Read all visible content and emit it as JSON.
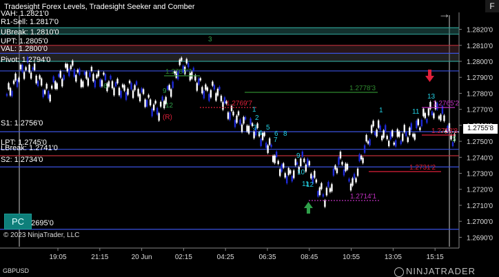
{
  "title": "Tradesight Forex Levels, Tradesight Seeker and Comber",
  "instrument": "GBPUSD",
  "copyright": "© 2023 NinjaTrader, LLC",
  "brand": "NINJATRADER",
  "buttons": {
    "pc": "PC",
    "f": "F",
    "nav_arrow": "→"
  },
  "current_price": "1.2755'8",
  "levels": [
    {
      "label": "VAH: 1.2821'0",
      "price": 1.2821,
      "color": "#2e9a8f"
    },
    {
      "label": "R1-Sell: 1.2817'0",
      "price": 1.2817,
      "color": "#2e9a8f"
    },
    {
      "label": "UBreak: 1.2810'0",
      "price": 1.281,
      "color": "#c0303a"
    },
    {
      "label": "UPT: 1.2805'0",
      "price": 1.2805,
      "color": "#3a52e0"
    },
    {
      "label": "VAL: 1.2800'0",
      "price": 1.28,
      "color": "#2e9a8f"
    },
    {
      "label": "Pivot: 1.2794'0",
      "price": 1.2794,
      "color": "#3a52e0"
    },
    {
      "label": "S1: 1.2756'0",
      "price": 1.2756,
      "color": "#3a52e0"
    },
    {
      "label": "LPT: 1.2745'0",
      "price": 1.2745,
      "color": "#3a52e0"
    },
    {
      "label": "LBreak: 1.2741'0",
      "price": 1.2741,
      "color": "#c0303a"
    },
    {
      "label": "S2: 1.2734'0",
      "price": 1.2734,
      "color": "#3a52e0"
    },
    {
      "label": "1.2695'0",
      "price": 1.2695,
      "color": "#3a52e0"
    }
  ],
  "annotations": [
    {
      "text": "1.2787'7",
      "color": "#2f8a2f"
    },
    {
      "text": "1.2778'3",
      "color": "#2f8a2f"
    },
    {
      "text": "1.2769'7",
      "color": "#e0203a"
    },
    {
      "text": "1.2765'2",
      "color": "#c030c0"
    },
    {
      "text": "1.2753'8",
      "color": "#e0203a"
    },
    {
      "text": "1.2731'2",
      "color": "#e0203a"
    },
    {
      "text": "1.2714'1",
      "color": "#c030c0"
    }
  ],
  "chart_data": {
    "type": "candlestick",
    "x_ticks": [
      "19:05",
      "21:15",
      "20 Jun",
      "02:15",
      "04:25",
      "06:35",
      "08:45",
      "10:55",
      "13:05",
      "15:15"
    ],
    "y_ticks": [
      1.282,
      1.281,
      1.28,
      1.279,
      1.278,
      1.277,
      1.276,
      1.275,
      1.274,
      1.273,
      1.272,
      1.271,
      1.27,
      1.269
    ],
    "y_tick_labels": [
      "1.2820'0",
      "1.2810'0",
      "1.2800'0",
      "1.2790'0",
      "1.2780'0",
      "1.2770'0",
      "1.2760'0",
      "1.2750'0",
      "1.2740'0",
      "1.2730'0",
      "1.2720'0",
      "1.2710'0",
      "1.2700'0",
      "1.2690'0"
    ],
    "ylim": [
      1.2685,
      1.2828
    ],
    "path": [
      [
        0,
        1.2779
      ],
      [
        4,
        1.2785
      ],
      [
        8,
        1.2793
      ],
      [
        12,
        1.2797
      ],
      [
        16,
        1.2793
      ],
      [
        20,
        1.2785
      ],
      [
        24,
        1.2779
      ],
      [
        28,
        1.2787
      ],
      [
        32,
        1.279
      ],
      [
        36,
        1.2797
      ],
      [
        40,
        1.2793
      ],
      [
        44,
        1.2788
      ],
      [
        48,
        1.2792
      ],
      [
        52,
        1.2789
      ],
      [
        56,
        1.2789
      ],
      [
        60,
        1.2786
      ],
      [
        64,
        1.2784
      ],
      [
        68,
        1.2781
      ],
      [
        72,
        1.2784
      ],
      [
        76,
        1.2782
      ],
      [
        80,
        1.2777
      ],
      [
        84,
        1.2772
      ],
      [
        88,
        1.2769
      ],
      [
        92,
        1.2778
      ],
      [
        96,
        1.2786
      ],
      [
        100,
        1.2798
      ],
      [
        104,
        1.2797
      ],
      [
        108,
        1.2791
      ],
      [
        112,
        1.2785
      ],
      [
        116,
        1.278
      ],
      [
        120,
        1.2783
      ],
      [
        124,
        1.2778
      ],
      [
        128,
        1.2769
      ],
      [
        132,
        1.2765
      ],
      [
        136,
        1.2762
      ],
      [
        140,
        1.276
      ],
      [
        144,
        1.2757
      ],
      [
        148,
        1.2752
      ],
      [
        152,
        1.2747
      ],
      [
        156,
        1.2738
      ],
      [
        160,
        1.2731
      ],
      [
        164,
        1.2728
      ],
      [
        168,
        1.2735
      ],
      [
        172,
        1.2739
      ],
      [
        176,
        1.2731
      ],
      [
        180,
        1.2721
      ],
      [
        184,
        1.2715
      ],
      [
        188,
        1.2724
      ],
      [
        192,
        1.2739
      ],
      [
        196,
        1.2733
      ],
      [
        200,
        1.2722
      ],
      [
        204,
        1.2736
      ],
      [
        208,
        1.2748
      ],
      [
        212,
        1.2758
      ],
      [
        216,
        1.2757
      ],
      [
        220,
        1.2753
      ],
      [
        224,
        1.2751
      ],
      [
        228,
        1.2753
      ],
      [
        232,
        1.2755
      ],
      [
        236,
        1.2756
      ],
      [
        240,
        1.2763
      ],
      [
        244,
        1.2768
      ],
      [
        248,
        1.277
      ],
      [
        252,
        1.2766
      ],
      [
        256,
        1.2755
      ],
      [
        260,
        1.2749
      ]
    ],
    "seq_labels": [
      "1",
      "2",
      "3",
      "4",
      "5",
      "6",
      "7",
      "8",
      "9",
      "10",
      "11",
      "12",
      "13"
    ],
    "arrows": [
      "sell",
      "buy"
    ]
  }
}
